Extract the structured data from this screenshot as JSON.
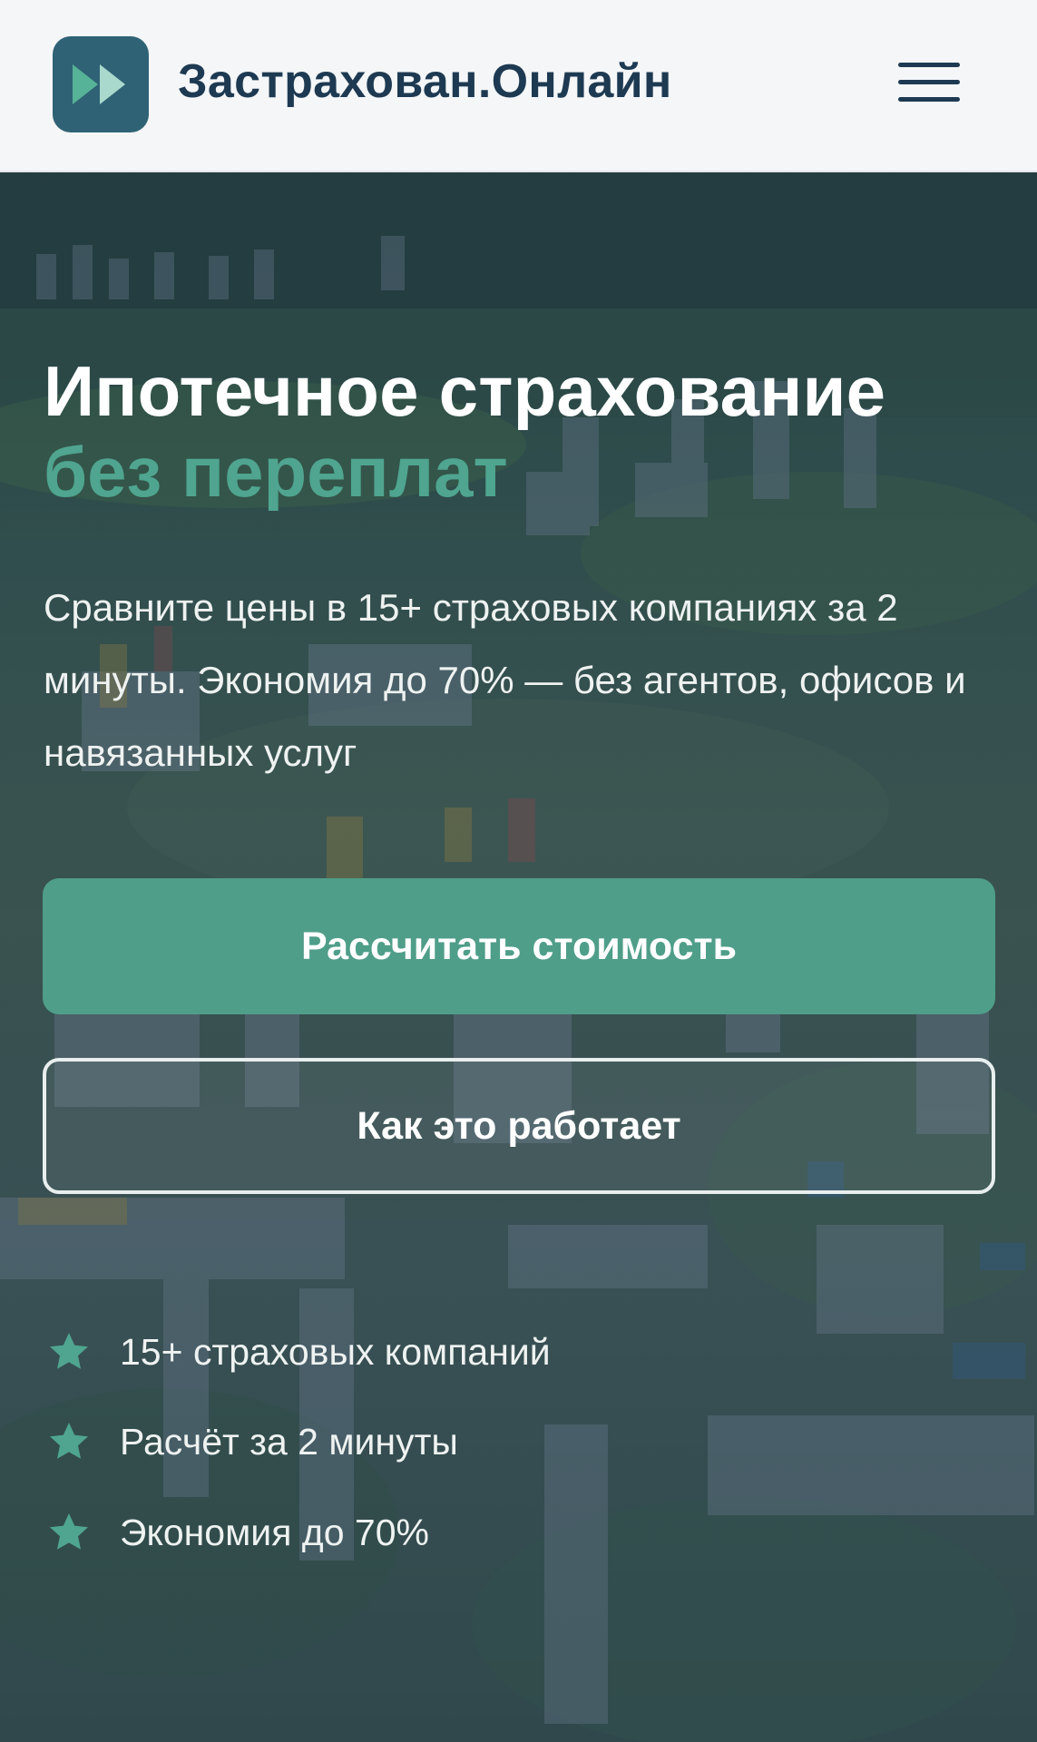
{
  "header": {
    "brand": "Застрахован.Онлайн",
    "logo_icon": "fast-forward-icon",
    "menu_icon": "hamburger-menu-icon"
  },
  "hero": {
    "title_line1": "Ипотечное страхование",
    "title_line2": "без переплат",
    "subtitle": "Сравните цены в 15+ страховых компаниях за 2 минуты. Экономия до 70% — без агентов, офисов и навязанных услуг",
    "primary_button": "Рассчитать стоимость",
    "secondary_button": "Как это работает",
    "features": [
      {
        "icon": "star-icon",
        "text": "15+ страховых компаний"
      },
      {
        "icon": "star-icon",
        "text": "Расчёт за 2 минуты"
      },
      {
        "icon": "star-icon",
        "text": "Экономия до 70%"
      }
    ]
  },
  "colors": {
    "brand_dark": "#1e3a52",
    "logo_bg": "#2f6275",
    "accent_green": "#4fa58f",
    "button_green": "#4f9e89",
    "header_bg": "#f4f6f8"
  }
}
